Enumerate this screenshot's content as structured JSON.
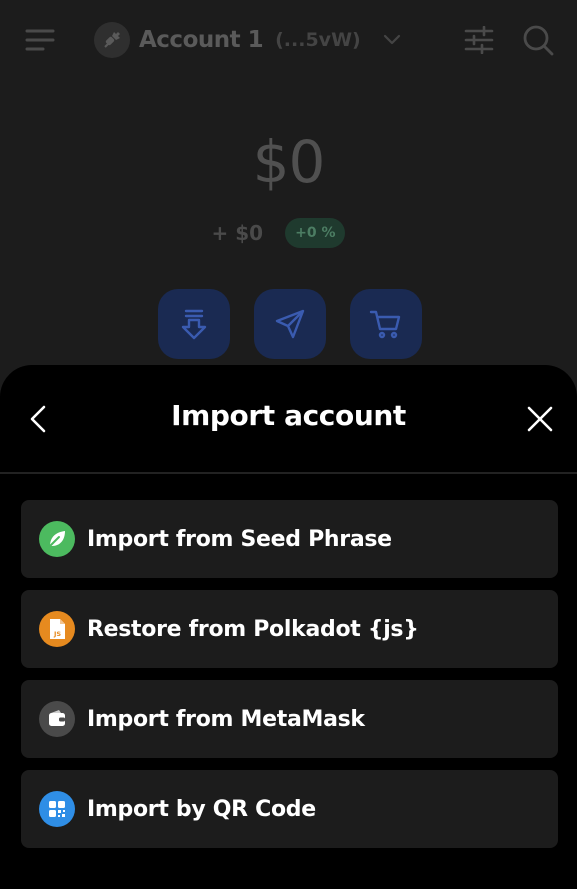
{
  "header": {
    "menu_icon": "menu-icon",
    "account_name": "Account 1",
    "account_address": "(...5vW)",
    "filter_icon": "sliders-icon",
    "search_icon": "search-icon"
  },
  "wallet": {
    "balance": "$0",
    "change_value": "+ $0",
    "change_percent": "+0 %",
    "actions": [
      "receive-icon",
      "send-icon",
      "buy-icon"
    ]
  },
  "modal": {
    "title": "Import account",
    "options": [
      {
        "label": "Import from Seed Phrase",
        "icon": "leaf-icon",
        "color": "#4cba5f"
      },
      {
        "label": "Restore from Polkadot {js}",
        "icon": "js-file-icon",
        "color": "#e68a1f"
      },
      {
        "label": "Import from MetaMask",
        "icon": "wallet-icon",
        "color": "#4a4a4a"
      },
      {
        "label": "Import by QR Code",
        "icon": "qr-code-icon",
        "color": "#2f8ee6"
      }
    ]
  },
  "colors": {
    "background": "#1c1c1c",
    "sheet": "#000000",
    "option_bg": "#1c1c1c",
    "accent_blue": "#1a2a52",
    "badge_green": "#1f3a2e"
  }
}
